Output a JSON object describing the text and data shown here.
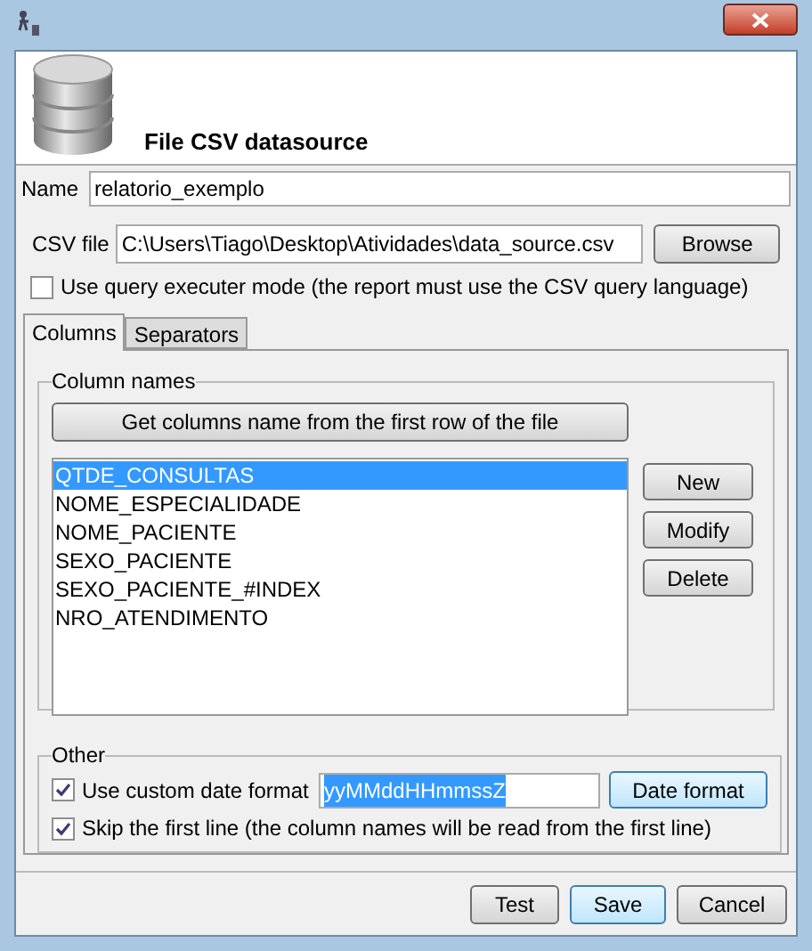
{
  "header": {
    "title": "File CSV datasource"
  },
  "name_field": {
    "label": "Name",
    "value": "relatorio_exemplo"
  },
  "csv_field": {
    "label": "CSV file",
    "value": "C:\\Users\\Tiago\\Desktop\\Atividades\\data_source.csv",
    "button": "Browse"
  },
  "query_mode": {
    "label": "Use query executer mode (the report must use the CSV query language)",
    "checked": false
  },
  "tabs": [
    {
      "label": "Columns",
      "selected": true
    },
    {
      "label": "Separators",
      "selected": false
    }
  ],
  "column_names": {
    "legend": "Column names",
    "get_button": "Get columns name from the first row of the file",
    "items": [
      {
        "label": "QTDE_CONSULTAS",
        "selected": true
      },
      {
        "label": "NOME_ESPECIALIDADE",
        "selected": false
      },
      {
        "label": "NOME_PACIENTE",
        "selected": false
      },
      {
        "label": "SEXO_PACIENTE",
        "selected": false
      },
      {
        "label": "SEXO_PACIENTE_#INDEX",
        "selected": false
      },
      {
        "label": "NRO_ATENDIMENTO",
        "selected": false
      }
    ],
    "buttons": [
      "New",
      "Modify",
      "Delete"
    ]
  },
  "other": {
    "legend": "Other",
    "date_format": {
      "label": "Use custom date format",
      "checked": true,
      "value": "yyMMddHHmmssZ",
      "button": "Date format"
    },
    "skip_first": {
      "label": "Skip the first line (the column names will be read from the first line)",
      "checked": true
    }
  },
  "footer_buttons": [
    {
      "label": "Test",
      "default": false
    },
    {
      "label": "Save",
      "default": true
    },
    {
      "label": "Cancel",
      "default": false
    }
  ]
}
